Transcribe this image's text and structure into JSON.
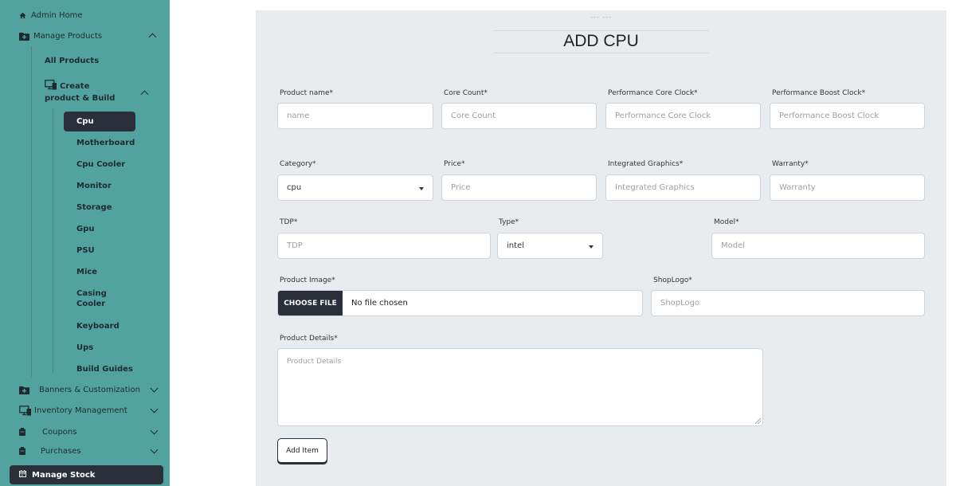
{
  "sidebar": {
    "admin_home": "Admin Home",
    "manage_products": "Manage Products",
    "all_products": "All Products",
    "create_build_line1": "Create",
    "create_build_line2": "product & Build",
    "sub_items": [
      "Cpu",
      "Motherboard",
      "Cpu Cooler",
      "Monitor",
      "Storage",
      "Gpu",
      "PSU",
      "Mice",
      "Casing",
      "Keyboard",
      "Ups",
      "Build Guides"
    ],
    "casing_line2": "Cooler",
    "banners": "Banners & Customization",
    "inventory": "Inventory Management",
    "coupons": "Coupons",
    "purchases": "Purchases",
    "manage_stock": "Manage Stock",
    "active_item": "Cpu"
  },
  "main": {
    "breadcrumb": "--- ---",
    "title": "ADD CPU",
    "fields": {
      "product_name": {
        "label": "Product name*",
        "placeholder": "name"
      },
      "core_count": {
        "label": "Core Count*",
        "placeholder": "Core Count"
      },
      "perf_core_clock": {
        "label": "Performance Core Clock*",
        "placeholder": "Performance Core Clock"
      },
      "perf_boost_clock": {
        "label": "Performance Boost Clock*",
        "placeholder": "Performance Boost Clock"
      },
      "category": {
        "label": "Category*",
        "value": "cpu"
      },
      "price": {
        "label": "Price*",
        "placeholder": "Price"
      },
      "integrated_graphics": {
        "label": "Integrated Graphics*",
        "placeholder": "Integrated Graphics"
      },
      "warranty": {
        "label": "Warranty*",
        "placeholder": "Warranty"
      },
      "tdp": {
        "label": "TDP*",
        "placeholder": "TDP"
      },
      "type": {
        "label": "Type*",
        "value": "intel"
      },
      "model": {
        "label": "Model*",
        "placeholder": "Model"
      },
      "product_image": {
        "label": "Product Image*",
        "button": "CHOOSE FILE",
        "status": "No file chosen"
      },
      "shop_logo": {
        "label": "ShopLogo*",
        "placeholder": "ShopLogo"
      },
      "product_details": {
        "label": "Product Details*",
        "placeholder": "Product Details"
      }
    },
    "submit": "Add Item"
  }
}
